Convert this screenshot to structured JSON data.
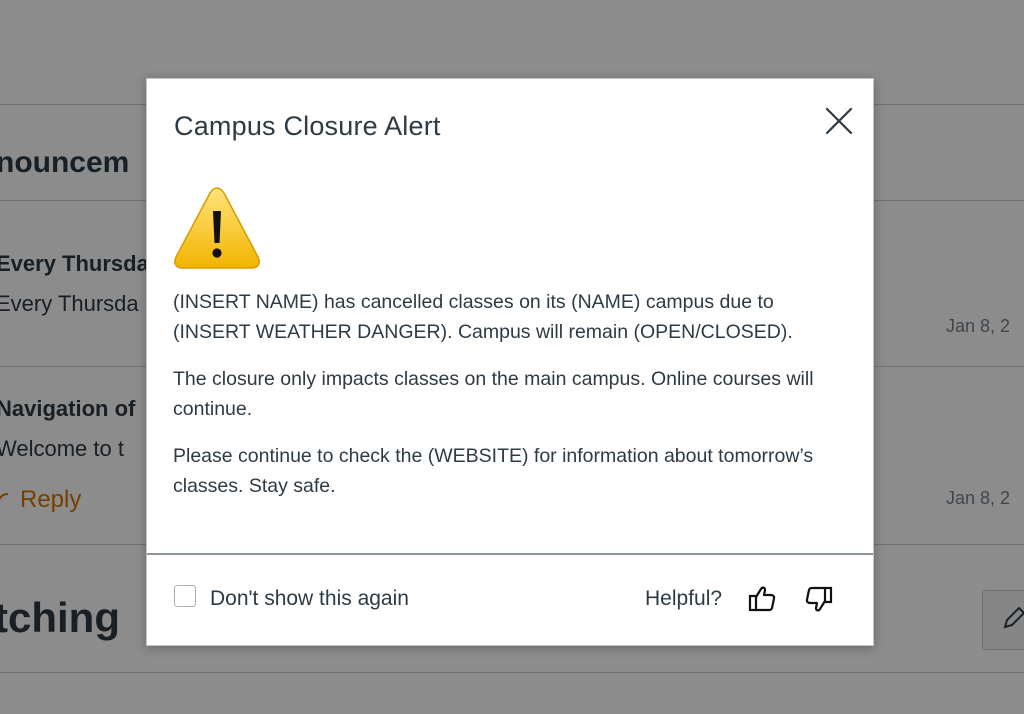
{
  "background": {
    "heading_fragment": "nouncem",
    "items": [
      {
        "title": "Every Thursda",
        "preview": "Every Thursda",
        "date": "Jan 8, 2"
      },
      {
        "title": "Navigation of",
        "preview": "Welcome to t",
        "reply_label": "Reply",
        "date": "Jan 8, 2"
      }
    ],
    "watching_fragment": "tching"
  },
  "modal": {
    "title": "Campus Closure Alert",
    "paragraphs": [
      "(INSERT NAME) has cancelled classes on its (NAME) campus due to (INSERT WEATHER DANGER). Campus will remain (OPEN/CLOSED).",
      "The closure only impacts classes on the main campus. Online courses will continue.",
      "Please continue to check the (WEBSITE) for information about tomorrow’s classes. Stay safe."
    ],
    "footer": {
      "checkbox_label": "Don't show this again",
      "checkbox_checked": false,
      "helpful_label": "Helpful?"
    },
    "icons": {
      "close": "close-icon",
      "warning": "warning-icon",
      "thumbs_up": "thumbs-up-icon",
      "thumbs_down": "thumbs-down-icon"
    }
  },
  "colors": {
    "text": "#2d3b45",
    "reply_accent": "#d47500",
    "warning_yellow": "#f5c400"
  }
}
